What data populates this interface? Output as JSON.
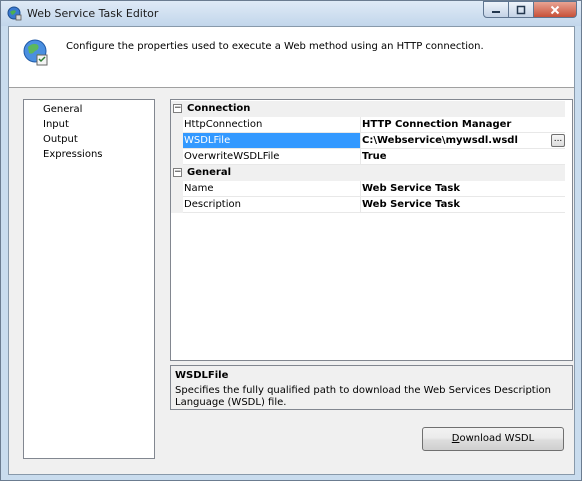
{
  "window": {
    "title": "Web Service Task Editor",
    "min_icon": "minimize-icon",
    "max_icon": "maximize-icon",
    "close_icon": "close-icon"
  },
  "header": {
    "icon": "web-service-globe-icon",
    "text": "Configure the properties used to execute a Web method using an HTTP connection."
  },
  "nav": {
    "items": [
      {
        "label": "General",
        "selected": true
      },
      {
        "label": "Input",
        "selected": false
      },
      {
        "label": "Output",
        "selected": false
      },
      {
        "label": "Expressions",
        "selected": false
      }
    ]
  },
  "grid": {
    "categories": [
      {
        "label": "Connection",
        "toggle": "−",
        "properties": [
          {
            "name": "HttpConnection",
            "value": "HTTP Connection Manager",
            "selected": false
          },
          {
            "name": "WSDLFile",
            "value": "C:\\Webservice\\mywsdl.wsdl",
            "selected": true,
            "button": "..."
          },
          {
            "name": "OverwriteWSDLFile",
            "value": "True",
            "selected": false
          }
        ]
      },
      {
        "label": "General",
        "toggle": "−",
        "properties": [
          {
            "name": "Name",
            "value": "Web Service Task",
            "selected": false
          },
          {
            "name": "Description",
            "value": "Web Service Task",
            "selected": false
          }
        ]
      }
    ]
  },
  "description": {
    "title": "WSDLFile",
    "text": "Specifies the fully qualified path to download the Web Services Description Language (WSDL) file."
  },
  "buttons": {
    "download_wsdl_accel": "D",
    "download_wsdl_rest": "ownload WSDL"
  },
  "colors": {
    "selection": "#3399ff",
    "window_frame": "#c9dcee",
    "close_button": "#c75038"
  }
}
